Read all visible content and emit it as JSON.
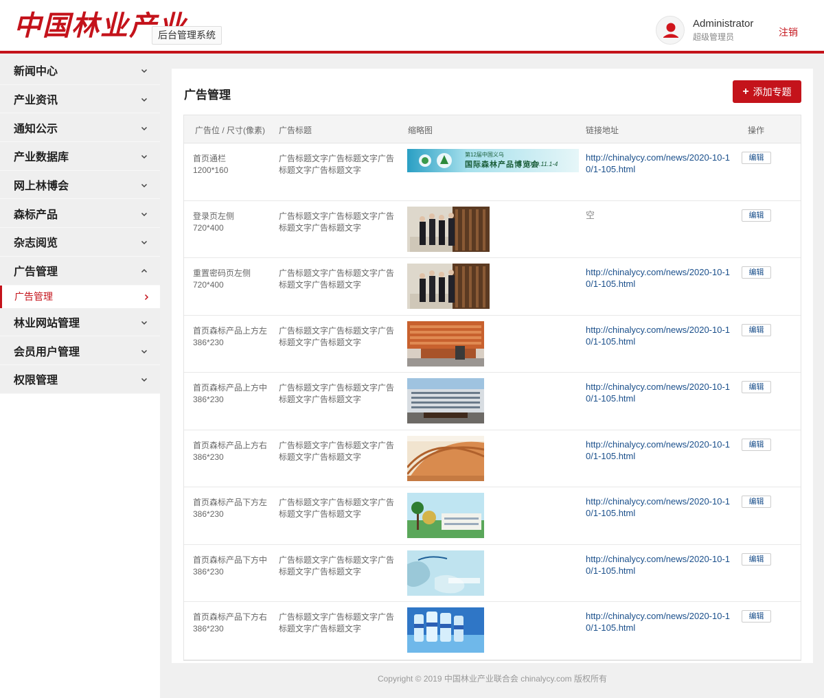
{
  "header": {
    "logo_text": "中国林业产业",
    "system_name": "后台管理系统",
    "user_name": "Administrator",
    "user_role": "超级管理员",
    "logout_label": "注销"
  },
  "sidebar": {
    "items": [
      {
        "label": "新闻中心",
        "expanded": false
      },
      {
        "label": "产业资讯",
        "expanded": false
      },
      {
        "label": "通知公示",
        "expanded": false
      },
      {
        "label": "产业数据库",
        "expanded": false
      },
      {
        "label": "网上林博会",
        "expanded": false
      },
      {
        "label": "森标产品",
        "expanded": false
      },
      {
        "label": "杂志阅览",
        "expanded": false
      },
      {
        "label": "广告管理",
        "expanded": true
      },
      {
        "label": "林业网站管理",
        "expanded": false
      },
      {
        "label": "会员用户管理",
        "expanded": false
      },
      {
        "label": "权限管理",
        "expanded": false
      }
    ],
    "active_sub": "广告管理"
  },
  "main": {
    "title": "广告管理",
    "add_button_label": "添加专题",
    "columns": [
      "广告位 / 尺寸(像素)",
      "广告标题",
      "缩略图",
      "链接地址",
      "操作"
    ],
    "rows": [
      {
        "position": "首页通栏",
        "size": "1200*160",
        "title": "广告标题文字广告标题文字广告标题文字广告标题文字",
        "thumb": "banner",
        "banner_text": "第12届中国义乌",
        "banner_text2": "国际森林产品博览会",
        "banner_date": "2019.11.1-4",
        "link": "http://chinalycy.com/news/2020-10-10/1-105.html",
        "action": "编辑"
      },
      {
        "position": "登录页左侧",
        "size": "720*400",
        "title": "广告标题文字广告标题文字广告标题文字广告标题文字",
        "thumb": "meeting",
        "link": "空",
        "action": "编辑"
      },
      {
        "position": "重置密码页左侧",
        "size": "720*400",
        "title": "广告标题文字广告标题文字广告标题文字广告标题文字",
        "thumb": "meeting",
        "link": "http://chinalycy.com/news/2020-10-10/1-105.html",
        "action": "编辑"
      },
      {
        "position": "首页森标产品上方左",
        "size": "386*230",
        "title": "广告标题文字广告标题文字广告标题文字广告标题文字",
        "thumb": "lumber",
        "link": "http://chinalycy.com/news/2020-10-10/1-105.html",
        "action": "编辑"
      },
      {
        "position": "首页森标产品上方中",
        "size": "386*230",
        "title": "广告标题文字广告标题文字广告标题文字广告标题文字",
        "thumb": "building",
        "link": "http://chinalycy.com/news/2020-10-10/1-105.html",
        "action": "编辑"
      },
      {
        "position": "首页森标产品上方右",
        "size": "386*230",
        "title": "广告标题文字广告标题文字广告标题文字广告标题文字",
        "thumb": "warehouse",
        "link": "http://chinalycy.com/news/2020-10-10/1-105.html",
        "action": "编辑"
      },
      {
        "position": "首页森标产品下方左",
        "size": "386*230",
        "title": "广告标题文字广告标题文字广告标题文字广告标题文字",
        "thumb": "resort",
        "link": "http://chinalycy.com/news/2020-10-10/1-105.html",
        "action": "编辑"
      },
      {
        "position": "首页森标产品下方中",
        "size": "386*230",
        "title": "广告标题文字广告标题文字广告标题文字广告标题文字",
        "thumb": "map",
        "link": "http://chinalycy.com/news/2020-10-10/1-105.html",
        "action": "编辑"
      },
      {
        "position": "首页森标产品下方右",
        "size": "386*230",
        "title": "广告标题文字广告标题文字广告标题文字广告标题文字",
        "thumb": "water",
        "link": "http://chinalycy.com/news/2020-10-10/1-105.html",
        "action": "编辑"
      }
    ]
  },
  "footer": {
    "copyright": "Copyright © 2019 中国林业产业联合会 chinalycy.com 版权所有"
  },
  "colors": {
    "brand_red": "#c4131b",
    "link_blue": "#1a4f8b"
  },
  "icons": {
    "avatar": "user-avatar-icon",
    "expand": "chevron-down-icon",
    "collapse": "chevron-up-icon",
    "sub_arrow": "chevron-right-icon",
    "add": "plus-icon"
  }
}
